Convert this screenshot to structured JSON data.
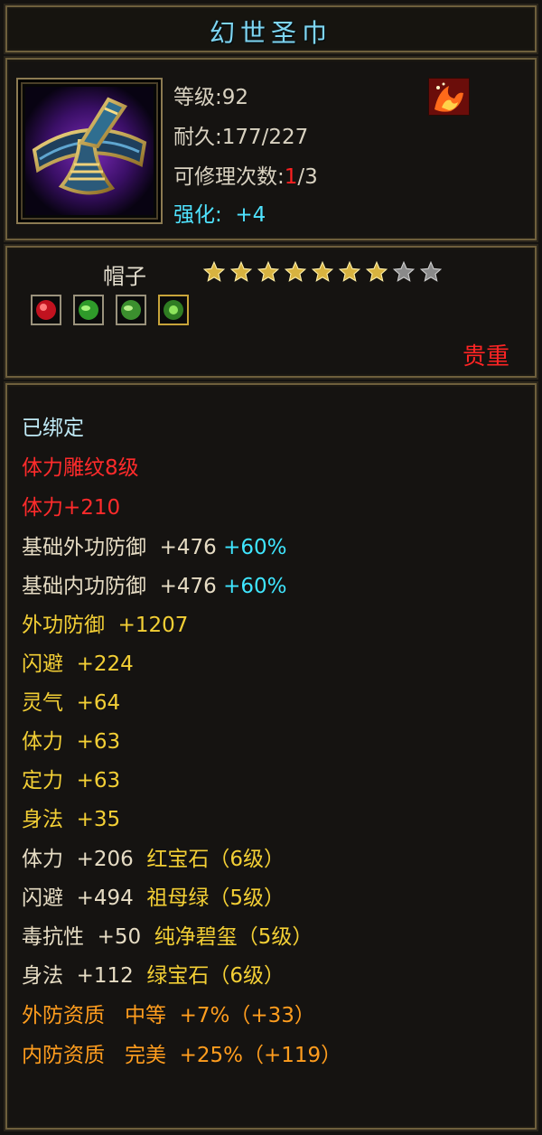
{
  "title": "幻世圣巾",
  "stats": {
    "level_label": "等级",
    "level_value": "92",
    "durability_label": "耐久",
    "durability_value": "177/227",
    "repair_label": "可修理次数",
    "repair_used": "1",
    "repair_total": "/3",
    "enhance_label": "强化:",
    "enhance_value": "+4"
  },
  "item": {
    "type_name": "帽子",
    "stars_filled": 7,
    "stars_total": 9,
    "gems": [
      "red-gem-icon",
      "green-gem-icon",
      "green-gem-icon",
      "green-gem-icon"
    ],
    "rarity": "贵重"
  },
  "attributes": [
    {
      "label": "已绑定",
      "value": "",
      "extra": "",
      "colors": {
        "label": "#bfe9f5"
      }
    },
    {
      "label": "体力雕纹8级",
      "value": "",
      "extra": ""
    },
    {
      "label": "体力+210",
      "value": "",
      "extra": ""
    },
    {
      "label": "基础外功防御",
      "value": "+476",
      "extra": "+60%"
    },
    {
      "label": "基础内功防御",
      "value": "+476",
      "extra": "+60%"
    },
    {
      "label": "外功防御",
      "value": "+1207",
      "extra": ""
    },
    {
      "label": "闪避",
      "value": "+224",
      "extra": ""
    },
    {
      "label": "灵气",
      "value": "+64",
      "extra": ""
    },
    {
      "label": "体力",
      "value": "+63",
      "extra": ""
    },
    {
      "label": "定力",
      "value": "+63",
      "extra": ""
    },
    {
      "label": "身法",
      "value": "+35",
      "extra": ""
    },
    {
      "label": "体力",
      "value": "+206",
      "extra": "红宝石（6级）"
    },
    {
      "label": "闪避",
      "value": "+494",
      "extra": "祖母绿（5级）"
    },
    {
      "label": "毒抗性",
      "value": "+50",
      "extra": "纯净碧玺（5级）"
    },
    {
      "label": "身法",
      "value": "+112",
      "extra": "绿宝石（6级）"
    },
    {
      "label": "外防资质",
      "value": "中等",
      "extra": "+7%（+33）"
    },
    {
      "label": "内防资质",
      "value": "完美",
      "extra": "+25%（+119）"
    }
  ],
  "colors": {
    "title": "#7fd6f2",
    "bound": "#bfe9f5",
    "red": "#ff2b2b",
    "gold": "#f3cf35",
    "cyan": "#3fe6ff",
    "orange": "#ff9d1e",
    "border": "#6e5f3c"
  }
}
